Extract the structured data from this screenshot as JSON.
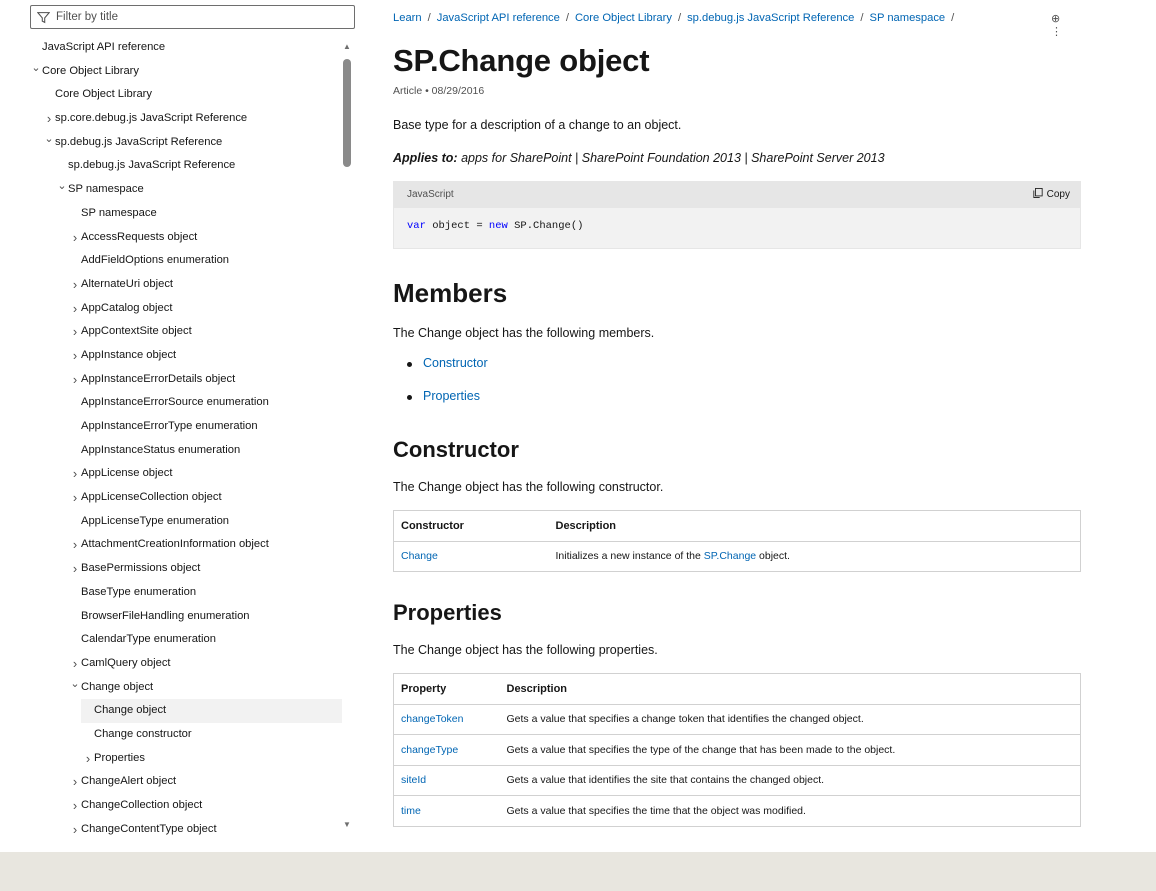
{
  "filter": {
    "placeholder": "Filter by title"
  },
  "toc": {
    "items": [
      {
        "label": "JavaScript API reference",
        "indent": 0,
        "chevron": ""
      },
      {
        "label": "Core Object Library",
        "indent": 0,
        "chevron": "down"
      },
      {
        "label": "Core Object Library",
        "indent": 1,
        "chevron": ""
      },
      {
        "label": "sp.core.debug.js JavaScript Reference",
        "indent": 1,
        "chevron": "right"
      },
      {
        "label": "sp.debug.js JavaScript Reference",
        "indent": 1,
        "chevron": "down"
      },
      {
        "label": "sp.debug.js JavaScript Reference",
        "indent": 2,
        "chevron": ""
      },
      {
        "label": "SP namespace",
        "indent": 2,
        "chevron": "down"
      },
      {
        "label": "SP namespace",
        "indent": 3,
        "chevron": ""
      },
      {
        "label": "AccessRequests object",
        "indent": 3,
        "chevron": "right"
      },
      {
        "label": "AddFieldOptions enumeration",
        "indent": 3,
        "chevron": ""
      },
      {
        "label": "AlternateUri object",
        "indent": 3,
        "chevron": "right"
      },
      {
        "label": "AppCatalog object",
        "indent": 3,
        "chevron": "right"
      },
      {
        "label": "AppContextSite object",
        "indent": 3,
        "chevron": "right"
      },
      {
        "label": "AppInstance object",
        "indent": 3,
        "chevron": "right"
      },
      {
        "label": "AppInstanceErrorDetails object",
        "indent": 3,
        "chevron": "right"
      },
      {
        "label": "AppInstanceErrorSource enumeration",
        "indent": 3,
        "chevron": ""
      },
      {
        "label": "AppInstanceErrorType enumeration",
        "indent": 3,
        "chevron": ""
      },
      {
        "label": "AppInstanceStatus enumeration",
        "indent": 3,
        "chevron": ""
      },
      {
        "label": "AppLicense object",
        "indent": 3,
        "chevron": "right"
      },
      {
        "label": "AppLicenseCollection object",
        "indent": 3,
        "chevron": "right"
      },
      {
        "label": "AppLicenseType enumeration",
        "indent": 3,
        "chevron": ""
      },
      {
        "label": "AttachmentCreationInformation object",
        "indent": 3,
        "chevron": "right"
      },
      {
        "label": "BasePermissions object",
        "indent": 3,
        "chevron": "right"
      },
      {
        "label": "BaseType enumeration",
        "indent": 3,
        "chevron": ""
      },
      {
        "label": "BrowserFileHandling enumeration",
        "indent": 3,
        "chevron": ""
      },
      {
        "label": "CalendarType enumeration",
        "indent": 3,
        "chevron": ""
      },
      {
        "label": "CamlQuery object",
        "indent": 3,
        "chevron": "right"
      },
      {
        "label": "Change object",
        "indent": 3,
        "chevron": "down"
      },
      {
        "label": "Change object",
        "indent": 4,
        "chevron": "",
        "active": true
      },
      {
        "label": "Change constructor",
        "indent": 4,
        "chevron": ""
      },
      {
        "label": "Properties",
        "indent": 4,
        "chevron": "right"
      },
      {
        "label": "ChangeAlert object",
        "indent": 3,
        "chevron": "right"
      },
      {
        "label": "ChangeCollection object",
        "indent": 3,
        "chevron": "right"
      },
      {
        "label": "ChangeContentType object",
        "indent": 3,
        "chevron": "right"
      }
    ]
  },
  "breadcrumb": [
    "Learn",
    "JavaScript API reference",
    "Core Object Library",
    "sp.debug.js JavaScript Reference",
    "SP namespace"
  ],
  "actions": {
    "add_icon": "⊕",
    "more_icon": "⋮"
  },
  "article": {
    "title": "SP.Change object",
    "meta": "Article • 08/29/2016",
    "description": "Base type for a description of a change to an object.",
    "applies_label": "Applies to:",
    "applies_text": "apps for SharePoint | SharePoint Foundation 2013 | SharePoint Server 2013",
    "code": {
      "language": "JavaScript",
      "copy_label": "Copy",
      "kw1": "var",
      "part1": " object = ",
      "kw2": "new",
      "part2": " SP.Change()"
    },
    "members_heading": "Members",
    "members_text": "The Change object has the following members.",
    "members_links": [
      "Constructor",
      "Properties"
    ],
    "constructor_heading": "Constructor",
    "constructor_text": "The Change object has the following constructor.",
    "constructor_table": {
      "headers": [
        "Constructor",
        "Description"
      ],
      "rows": [
        {
          "name": "Change",
          "desc_before": "Initializes a new instance of the ",
          "desc_link": "SP.Change",
          "desc_after": " object."
        }
      ]
    },
    "properties_heading": "Properties",
    "properties_text": "The Change object has the following properties.",
    "properties_table": {
      "headers": [
        "Property",
        "Description"
      ],
      "rows": [
        {
          "name": "changeToken",
          "desc": "Gets a value that specifies a change token that identifies the changed object."
        },
        {
          "name": "changeType",
          "desc": "Gets a value that specifies the type of the change that has been made to the object."
        },
        {
          "name": "siteId",
          "desc": "Gets a value that identifies the site that contains the changed object."
        },
        {
          "name": "time",
          "desc": "Gets a value that specifies the time that the object was modified."
        }
      ]
    }
  }
}
